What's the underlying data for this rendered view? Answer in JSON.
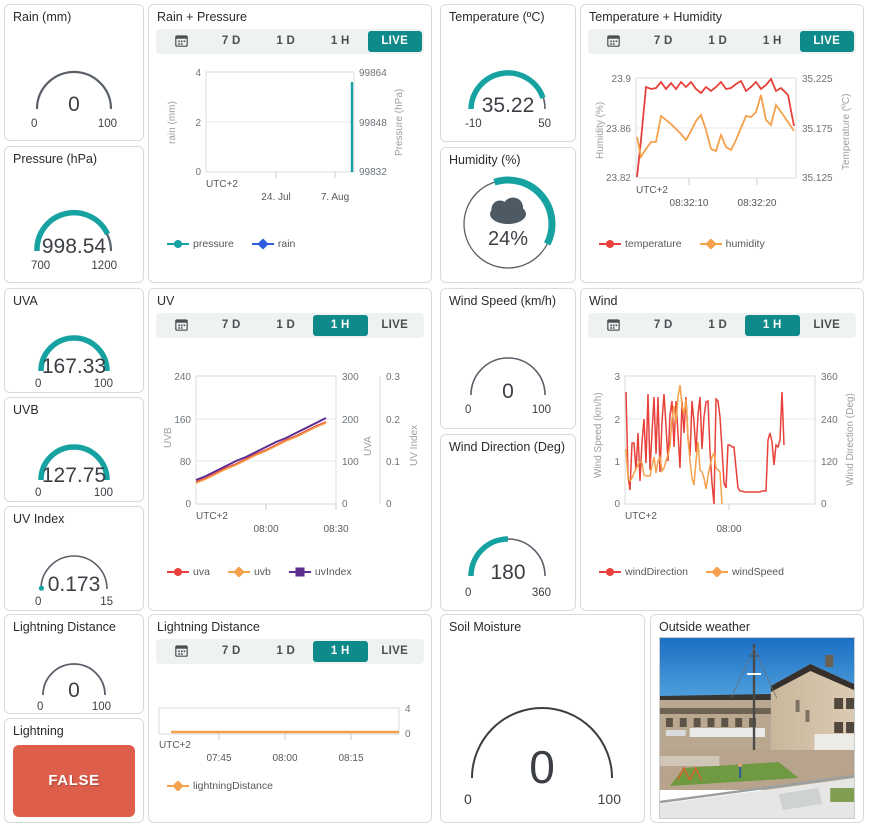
{
  "theme": {
    "teal": "#0e8a8a",
    "gauge_teal": "#17a2a2",
    "gauge_track": "#5a6068",
    "red": "#e8403a",
    "orange": "#f5a04a",
    "purple": "#5b2d8e",
    "blue": "#2f5fe0",
    "false_red": "#dd5f4b",
    "tabbar_bg": "#eef2f1",
    "panel_border": "#d7dbdb"
  },
  "tabs": {
    "calendar_icon": "calendar-icon",
    "labels": [
      "7 D",
      "1 D",
      "1 H",
      "LIVE"
    ]
  },
  "panels": {
    "rain_gauge": {
      "title": "Rain (mm)",
      "value": "0",
      "min": "0",
      "max": "100",
      "pct": 0
    },
    "pressure_gauge": {
      "title": "Pressure (hPa)",
      "value": "998.54",
      "min": "700",
      "max": "1200",
      "pct": 0.597
    },
    "temperature_gauge": {
      "title": "Temperature (ºC)",
      "value": "35.22",
      "min": "-10",
      "max": "50",
      "pct": 0.753
    },
    "humidity_gauge": {
      "title": "Humidity (%)",
      "value": "24%",
      "pct": 0.24,
      "icon": "cloud-icon"
    },
    "uva_gauge": {
      "title": "UVA",
      "value": "167.33",
      "min": "0",
      "max": "100",
      "pct": 1.0
    },
    "uvb_gauge": {
      "title": "UVB",
      "value": "127.75",
      "min": "0",
      "max": "100",
      "pct": 1.0
    },
    "uvindex_gauge": {
      "title": "UV Index",
      "value": "0.173",
      "min": "0",
      "max": "15",
      "pct": 0.0115
    },
    "windspeed_gauge": {
      "title": "Wind Speed (km/h)",
      "value": "0",
      "min": "0",
      "max": "100",
      "pct": 0
    },
    "winddir_gauge": {
      "title": "Wind Direction (Deg)",
      "value": "180",
      "min": "0",
      "max": "360",
      "pct": 0.5
    },
    "lightningdist_gauge": {
      "title": "Lightning Distance",
      "value": "0",
      "min": "0",
      "max": "100",
      "pct": 0
    },
    "lightning": {
      "title": "Lightning",
      "state": "FALSE"
    },
    "soil_gauge": {
      "title": "Soil Moisture",
      "value": "0",
      "min": "0",
      "max": "100",
      "pct": 0
    },
    "webcam": {
      "title": "Outside weather",
      "alt": "rooftop-webcam-view"
    },
    "rain_pressure_chart": {
      "title": "Rain + Pressure",
      "active_tab": "LIVE"
    },
    "temp_humidity_chart": {
      "title": "Temperature + Humidity",
      "active_tab": "LIVE"
    },
    "uv_chart": {
      "title": "UV",
      "active_tab": "1 H"
    },
    "wind_chart": {
      "title": "Wind",
      "active_tab": "1 H"
    },
    "lightning_chart": {
      "title": "Lightning Distance",
      "active_tab": "1 H"
    }
  },
  "chart_data": [
    {
      "id": "rain_pressure",
      "type": "line",
      "title": "Rain + Pressure",
      "xlabel": "UTC+2",
      "xticks": [
        "24. Jul",
        "7. Aug"
      ],
      "left_axis": {
        "label": "rain (mm)",
        "ticks": [
          "0",
          "2",
          "4"
        ],
        "ylim": [
          0,
          4
        ]
      },
      "right_axis": {
        "label": "Pressure (hPa)",
        "ticks": [
          "99832",
          "99848",
          "99864"
        ],
        "ylim": [
          99832,
          99864
        ]
      },
      "series": [
        {
          "name": "pressure",
          "color": "#17a2a2",
          "marker": "circle",
          "values": [
            99848
          ]
        },
        {
          "name": "rain",
          "color": "#2f5fe0",
          "marker": "diamond",
          "values": [
            0
          ]
        }
      ],
      "legend_position": "bottom"
    },
    {
      "id": "temp_humidity",
      "type": "line",
      "title": "Temperature + Humidity",
      "xlabel": "UTC+2",
      "xticks": [
        "08:32:10",
        "08:32:20"
      ],
      "left_axis": {
        "label": "Humidity (%)",
        "ticks": [
          "23.82",
          "23.86",
          "23.9"
        ],
        "ylim": [
          23.82,
          23.9
        ]
      },
      "right_axis": {
        "label": "Temperature (ºC)",
        "ticks": [
          "35.125",
          "35.175",
          "35.225"
        ],
        "ylim": [
          35.125,
          35.225
        ]
      },
      "series": [
        {
          "name": "temperature",
          "color": "#e8403a",
          "marker": "circle",
          "values": [
            35.126,
            35.163,
            35.215,
            35.213,
            35.214,
            35.222,
            35.213,
            35.22,
            35.213,
            35.221,
            35.216,
            35.221,
            35.214,
            35.21,
            35.216,
            35.212,
            35.216,
            35.221,
            35.213,
            35.214,
            35.218,
            35.222,
            35.212,
            35.216,
            35.221,
            35.213,
            35.217,
            35.224,
            35.212,
            35.215,
            35.207,
            35.176
          ]
        },
        {
          "name": "humidity",
          "color": "#f5a04a",
          "marker": "diamond",
          "values": [
            23.855,
            23.839,
            23.845,
            23.851,
            23.851,
            23.872,
            23.869,
            23.866,
            23.862,
            23.858,
            23.853,
            23.86,
            23.868,
            23.873,
            23.861,
            23.845,
            23.843,
            23.856,
            23.847,
            23.844,
            23.852,
            23.862,
            23.872,
            23.871,
            23.875,
            23.889,
            23.869,
            23.865,
            23.881,
            23.875,
            23.867,
            23.86
          ]
        }
      ],
      "legend_position": "bottom"
    },
    {
      "id": "uv",
      "type": "line",
      "title": "UV",
      "xlabel": "UTC+2",
      "xticks": [
        "08:00",
        "08:30"
      ],
      "left_axis": {
        "label": "UVB",
        "ticks": [
          "0",
          "80",
          "160",
          "240"
        ],
        "ylim": [
          0,
          240
        ]
      },
      "right_axis": {
        "label": "UVA",
        "ticks": [
          "0",
          "100",
          "200",
          "300"
        ],
        "ylim": [
          0,
          300
        ]
      },
      "right_axis2": {
        "label": "UV Index",
        "ticks": [
          "0",
          "0.1",
          "0.2",
          "0.3"
        ],
        "ylim": [
          0,
          0.3
        ]
      },
      "series": [
        {
          "name": "uva",
          "color": "#e8403a",
          "marker": "circle",
          "values": [
            54,
            62,
            70,
            79,
            87,
            95,
            103,
            111,
            119,
            127,
            135,
            143,
            151,
            159
          ]
        },
        {
          "name": "uvb",
          "color": "#f5a04a",
          "marker": "diamond",
          "values": [
            52,
            60,
            68,
            77,
            85,
            93,
            101,
            109,
            117,
            125,
            133,
            141,
            149,
            157
          ]
        },
        {
          "name": "uvIndex",
          "color": "#5b2d8e",
          "marker": "square",
          "values": [
            0.057,
            0.065,
            0.073,
            0.082,
            0.09,
            0.098,
            0.106,
            0.114,
            0.122,
            0.13,
            0.138,
            0.146,
            0.154,
            0.163
          ]
        }
      ],
      "legend_position": "bottom"
    },
    {
      "id": "wind",
      "type": "line",
      "title": "Wind",
      "xlabel": "UTC+2",
      "xticks": [
        "08:00"
      ],
      "left_axis": {
        "label": "Wind Speed (km/h)",
        "ticks": [
          "0",
          "1",
          "2",
          "3"
        ],
        "ylim": [
          0,
          3
        ]
      },
      "right_axis": {
        "label": "Wind Direction (Deg)",
        "ticks": [
          "0",
          "120",
          "240",
          "360"
        ],
        "ylim": [
          0,
          360
        ]
      },
      "series": [
        {
          "name": "windDirection",
          "color": "#e8403a",
          "marker": "circle",
          "values": [
            315,
            80,
            40,
            170,
            170,
            95,
            200,
            65,
            175,
            240,
            115,
            310,
            95,
            200,
            300,
            140,
            300,
            90,
            230,
            310,
            220,
            120,
            250,
            290,
            160,
            290,
            200,
            100,
            285,
            200,
            300,
            185,
            135,
            290,
            230,
            145,
            250,
            300,
            155,
            245,
            285,
            290,
            150,
            60,
            0,
            295,
            290,
            245,
            150,
            60,
            45,
            165,
            165,
            160,
            160,
            100,
            45,
            38,
            36,
            35,
            35,
            35,
            35,
            35,
            35,
            35,
            35,
            35,
            35,
            36,
            36,
            36,
            180,
            200,
            175,
            110,
            165,
            160,
            175,
            315,
            165
          ]
        },
        {
          "name": "windSpeed",
          "color": "#f5a04a",
          "marker": "diamond",
          "values": [
            1.3,
            0.62,
            0.55,
            0.6,
            0.72,
            0.82,
            0.92,
            1.0,
            0.95,
            0.68,
            0.65,
            0.65,
            0.66,
            0.9,
            1.1,
            0.72,
            0.95,
            1.1,
            0.78,
            0.85,
            1.0,
            1.15,
            1.35,
            2.0,
            2.3,
            1.9,
            2.5,
            2.8,
            2.3,
            2.1,
            2.45,
            1.55,
            0.95,
            0.6,
            0.45,
            0.95,
            1.45,
            0.8,
            0.75,
            0.6,
            0.35,
            0.65,
            0.9,
            1.1,
            1.2,
            0.85,
            0.8,
            0.75,
            0.0
          ]
        }
      ],
      "legend_position": "bottom"
    },
    {
      "id": "lightning_distance",
      "type": "line",
      "title": "Lightning Distance",
      "xlabel": "UTC+2",
      "xticks": [
        "07:45",
        "08:00",
        "08:15"
      ],
      "right_axis": {
        "label": "",
        "ticks": [
          "0",
          "4"
        ],
        "ylim": [
          0,
          4
        ]
      },
      "series": [
        {
          "name": "lightningDistance",
          "color": "#f5a04a",
          "marker": "diamond",
          "values": [
            0,
            0,
            0,
            0,
            0,
            0,
            0,
            0
          ]
        }
      ],
      "legend_position": "bottom"
    }
  ]
}
